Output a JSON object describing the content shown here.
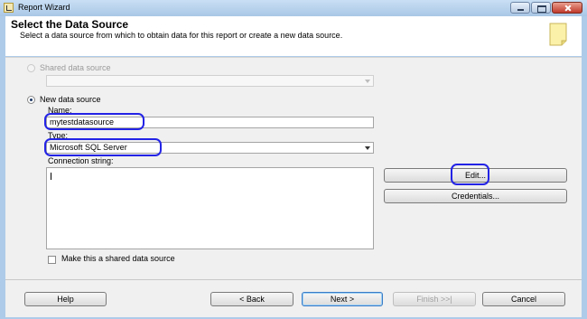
{
  "window": {
    "title": "Report Wizard"
  },
  "header": {
    "title": "Select the Data Source",
    "subtitle": "Select a data source from which to obtain data for this report or create a new data source."
  },
  "shared_source": {
    "label": "Shared data source",
    "value": ""
  },
  "new_source": {
    "label": "New data source",
    "name_label": "Name:",
    "name_value": "mytestdatasource",
    "type_label": "Type:",
    "type_value": "Microsoft SQL Server",
    "conn_label": "Connection string:",
    "conn_value": ""
  },
  "buttons": {
    "edit": "Edit...",
    "credentials": "Credentials...",
    "help": "Help",
    "back": "< Back",
    "next": "Next >",
    "finish": "Finish >>|",
    "cancel": "Cancel"
  },
  "make_shared": {
    "label": "Make this a shared data source",
    "checked": false
  },
  "icons": [
    "app-icon",
    "minimize-icon",
    "maximize-icon",
    "close-icon",
    "document-icon",
    "dropdown-arrow-icon"
  ],
  "colors": {
    "title_bar": "#a9c7e6",
    "annotation": "#2323e6",
    "default_button": "#3a7cc6"
  }
}
